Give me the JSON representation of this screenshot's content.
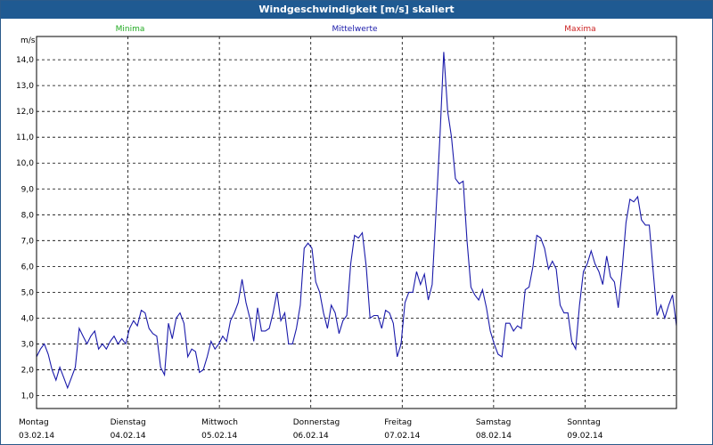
{
  "window": {
    "title": "Windgeschwindigkeit [m/s] skaliert"
  },
  "legend": {
    "minima": {
      "label": "Minima",
      "color": "#22aa22"
    },
    "mittelwerte": {
      "label": "Mittelwerte",
      "color": "#1a1aaa"
    },
    "maxima": {
      "label": "Maxima",
      "color": "#cc2222"
    }
  },
  "chart_data": {
    "type": "line",
    "title": "Windgeschwindigkeit [m/s] skaliert",
    "ylabel": "m/s",
    "ylim": [
      0.5,
      14.9
    ],
    "yticks": [
      "1,0",
      "2,0",
      "3,0",
      "4,0",
      "5,0",
      "6,0",
      "7,0",
      "8,0",
      "9,0",
      "10,0",
      "11,0",
      "12,0",
      "13,0",
      "14,0"
    ],
    "x_day_labels": [
      {
        "day": "Montag",
        "date": "03.02.14"
      },
      {
        "day": "Dienstag",
        "date": "04.02.14"
      },
      {
        "day": "Mittwoch",
        "date": "05.02.14"
      },
      {
        "day": "Donnerstag",
        "date": "06.02.14"
      },
      {
        "day": "Freitag",
        "date": "07.02.14"
      },
      {
        "day": "Samstag",
        "date": "08.02.14"
      },
      {
        "day": "Sonntag",
        "date": "09.02.14"
      }
    ],
    "grid": true,
    "series": [
      {
        "name": "Mittelwerte",
        "color": "#1a1aaa",
        "values": [
          2.5,
          2.8,
          3.0,
          2.6,
          2.0,
          1.6,
          2.1,
          1.7,
          1.3,
          1.7,
          2.1,
          3.6,
          3.3,
          3.0,
          3.3,
          3.5,
          2.8,
          3.0,
          2.8,
          3.1,
          3.3,
          3.0,
          3.2,
          3.0,
          3.6,
          3.9,
          3.7,
          4.3,
          4.2,
          3.6,
          3.4,
          3.3,
          2.1,
          1.8,
          3.8,
          3.2,
          4.0,
          4.2,
          3.8,
          2.5,
          2.8,
          2.7,
          1.9,
          2.0,
          2.5,
          3.1,
          2.8,
          3.0,
          3.3,
          3.1,
          3.9,
          4.2,
          4.6,
          5.5,
          4.6,
          4.0,
          3.1,
          4.4,
          3.5,
          3.5,
          3.6,
          4.2,
          5.0,
          3.9,
          4.2,
          3.0,
          3.0,
          3.6,
          4.5,
          6.7,
          6.9,
          6.7,
          5.4,
          5.0,
          4.2,
          3.6,
          4.5,
          4.2,
          3.4,
          3.9,
          4.1,
          6.1,
          7.2,
          7.1,
          7.3,
          6.0,
          4.0,
          4.1,
          4.1,
          3.6,
          4.3,
          4.2,
          3.8,
          2.5,
          3.0,
          4.6,
          5.0,
          5.0,
          5.8,
          5.3,
          5.7,
          4.7,
          5.3,
          8.1,
          11.0,
          14.3,
          12.0,
          11.0,
          9.4,
          9.2,
          9.3,
          7.0,
          5.2,
          4.9,
          4.7,
          5.1,
          4.4,
          3.5,
          3.0,
          2.6,
          2.5,
          3.8,
          3.8,
          3.5,
          3.7,
          3.6,
          5.1,
          5.2,
          6.0,
          7.2,
          7.1,
          6.7,
          5.9,
          6.2,
          5.9,
          4.5,
          4.2,
          4.2,
          3.1,
          2.8,
          4.5,
          5.8,
          6.1,
          6.6,
          6.1,
          5.8,
          5.3,
          6.4,
          5.6,
          5.4,
          4.4,
          5.9,
          7.7,
          8.6,
          8.5,
          8.7,
          7.8,
          7.6,
          7.6,
          5.8,
          4.1,
          4.5,
          4.0,
          4.5,
          4.9,
          3.7
        ]
      }
    ]
  }
}
